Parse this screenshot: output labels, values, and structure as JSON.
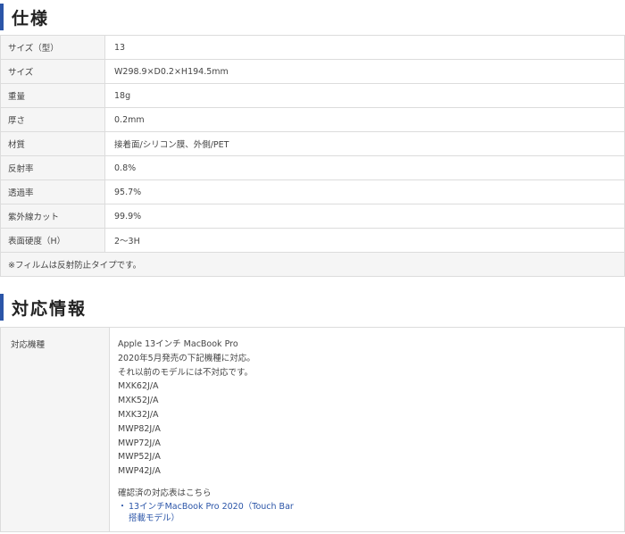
{
  "spec": {
    "title": "仕様",
    "rows": [
      {
        "label": "サイズ（型）",
        "value": "13"
      },
      {
        "label": "サイズ",
        "value": "W298.9×D0.2×H194.5mm"
      },
      {
        "label": "重量",
        "value": "18g"
      },
      {
        "label": "厚さ",
        "value": "0.2mm"
      },
      {
        "label": "材質",
        "value": "接着面/シリコン膜、外側/PET"
      },
      {
        "label": "反射率",
        "value": "0.8%"
      },
      {
        "label": "透過率",
        "value": "95.7%"
      },
      {
        "label": "紫外線カット",
        "value": "99.9%"
      },
      {
        "label": "表面硬度（H）",
        "value": "2〜3H"
      }
    ],
    "note": "※フィルムは反射防止タイプです。"
  },
  "compat": {
    "title": "対応情報",
    "label": "対応機種",
    "lines": [
      "Apple 13インチ MacBook Pro",
      "2020年5月発売の下記機種に対応。",
      "それ以前のモデルには不対応です。",
      "MXK62J/A",
      "MXK52J/A",
      "MXK32J/A",
      "MWP82J/A",
      "MWP72J/A",
      "MWP52J/A",
      "MWP42J/A"
    ],
    "confirmed_text": "確認済の対応表はこちら",
    "link_bullet": "・",
    "link_line1": "13インチMacBook Pro 2020（Touch Bar",
    "link_line2": "搭載モデル）"
  },
  "colors": {
    "accent": "#2b55a8",
    "label_bg": "#f5f5f5",
    "border": "#dcdcdc"
  }
}
